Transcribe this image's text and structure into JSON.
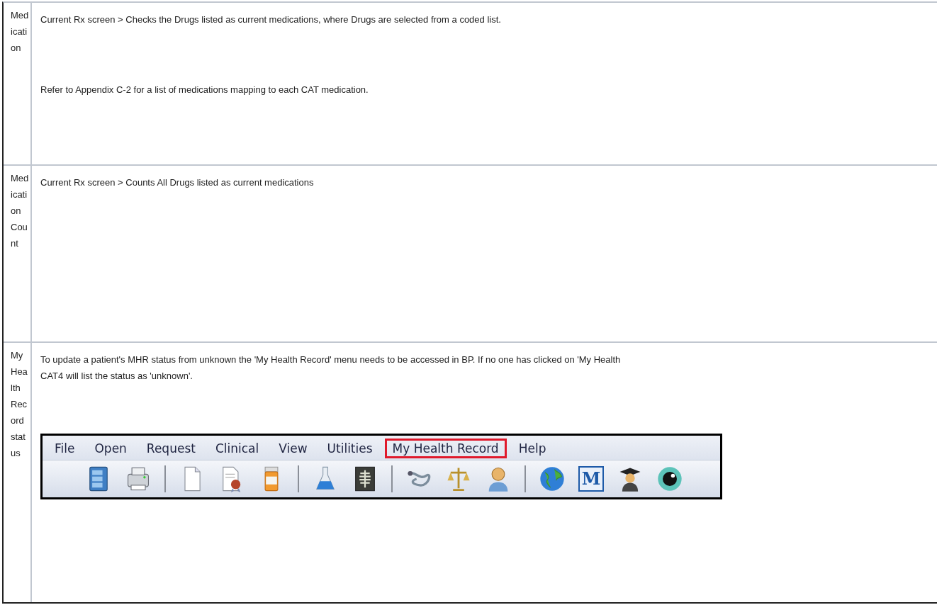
{
  "rows": [
    {
      "heading": "Medication",
      "paragraphs": [
        [
          "Current Rx screen > Checks the Drugs listed as current medications, where Drugs are selected from a coded list."
        ],
        [
          "Refer to Appendix C-2 for a list of medications mapping to each CAT medication."
        ]
      ]
    },
    {
      "heading": "Medication Count",
      "paragraphs": [
        [
          "Current Rx screen > Counts All Drugs listed as current medications"
        ]
      ]
    },
    {
      "heading": "My Health Record status",
      "paragraphs": [
        [
          "To update a patient's MHR status from unknown the 'My Health Record' menu needs to be accessed in BP. If no one has clicked on 'My Health",
          "CAT4 will list the status as 'unknown'."
        ]
      ],
      "screenshot": {
        "menu": [
          {
            "label": "File",
            "highlighted": false
          },
          {
            "label": "Open",
            "highlighted": false
          },
          {
            "label": "Request",
            "highlighted": false
          },
          {
            "label": "Clinical",
            "highlighted": false
          },
          {
            "label": "View",
            "highlighted": false
          },
          {
            "label": "Utilities",
            "highlighted": false
          },
          {
            "label": "My Health Record",
            "highlighted": true
          },
          {
            "label": "Help",
            "highlighted": false
          }
        ],
        "toolbar": [
          {
            "kind": "cabinet"
          },
          {
            "kind": "printer"
          },
          {
            "kind": "separator"
          },
          {
            "kind": "document"
          },
          {
            "kind": "certificate"
          },
          {
            "kind": "pill-bottle"
          },
          {
            "kind": "separator"
          },
          {
            "kind": "flask"
          },
          {
            "kind": "xray"
          },
          {
            "kind": "separator"
          },
          {
            "kind": "stethoscope"
          },
          {
            "kind": "scales"
          },
          {
            "kind": "person"
          },
          {
            "kind": "separator"
          },
          {
            "kind": "globe"
          },
          {
            "kind": "letter",
            "label": "M"
          },
          {
            "kind": "graduate"
          },
          {
            "kind": "eye"
          }
        ]
      }
    }
  ]
}
